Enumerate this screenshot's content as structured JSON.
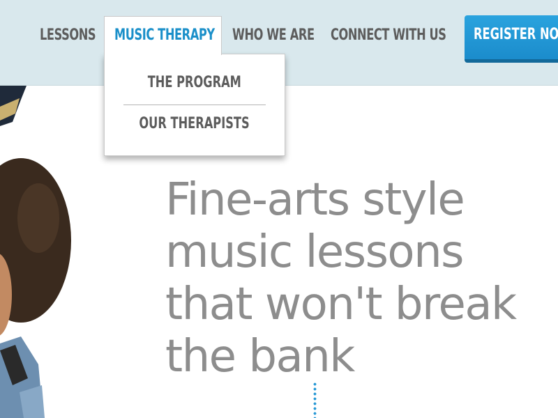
{
  "nav": {
    "items": [
      {
        "label": "LESSONS"
      },
      {
        "label": "MUSIC THERAPY",
        "active": true
      },
      {
        "label": "WHO WE ARE"
      },
      {
        "label": "CONNECT WITH US"
      }
    ],
    "register_label": "REGISTER NOW"
  },
  "dropdown": {
    "items": [
      {
        "label": "THE PROGRAM"
      },
      {
        "label": "OUR THERAPISTS"
      }
    ]
  },
  "hero": {
    "headline_lines": [
      "Fine-arts style",
      "music lessons",
      "that won't break",
      "the bank"
    ]
  },
  "colors": {
    "header_bg": "#d9e8ed",
    "accent": "#1a8fc9",
    "nav_text": "#5c5c5c",
    "headline_text": "#8d8d8d"
  }
}
